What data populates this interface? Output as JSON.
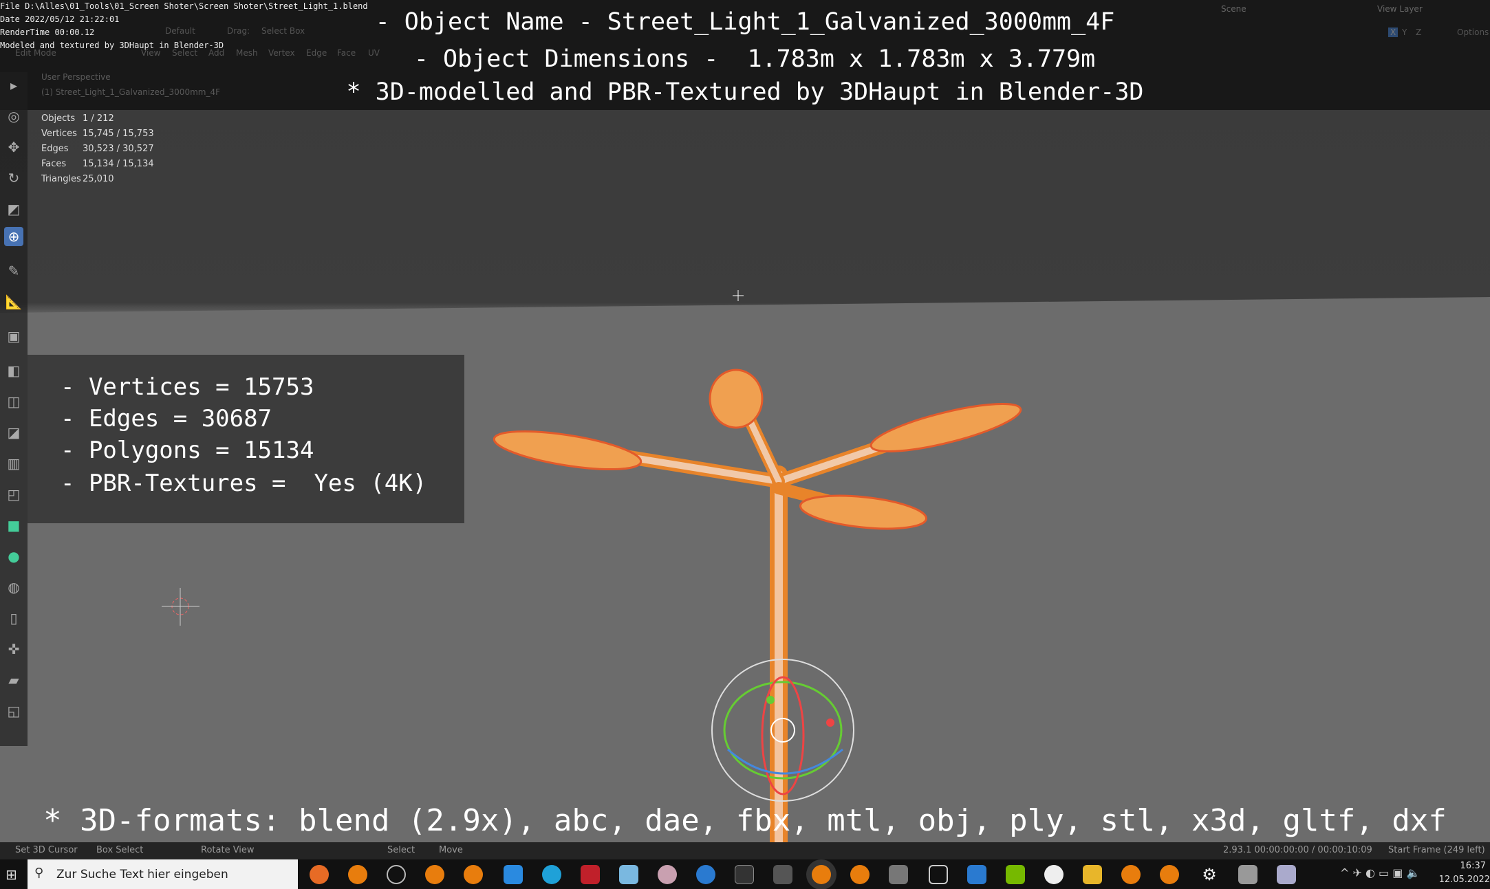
{
  "overlay": {
    "file": "File D:\\Alles\\01_Tools\\01_Screen Shoter\\Screen Shoter\\Street_Light_1.blend",
    "date": "Date 2022/05/12 21:22:01",
    "rendertime": "RenderTime 00:00.12",
    "credit": "Modeled and textured by 3DHaupt in Blender-3D"
  },
  "titles": [
    "- Object Name - Street_Light_1_Galvanized_3000mm_4F",
    "- Object Dimensions -  1.783m x 1.783m x 3.779m",
    "* 3D-modelled and PBR-Textured by 3DHaupt in Blender-3D"
  ],
  "header": {
    "mode": "Edit Mode",
    "menus": [
      "View",
      "Select",
      "Add",
      "Mesh",
      "Vertex",
      "Edge",
      "Face",
      "UV"
    ],
    "orientation": "Default",
    "drag_label": "Drag:",
    "drag_value": "Select Box",
    "scene": "Scene",
    "view_layer": "View Layer",
    "axes": [
      "X",
      "Y",
      "Z"
    ],
    "options": "Options"
  },
  "viewport": {
    "perspective": "User Perspective",
    "object": "(1) Street_Light_1_Galvanized_3000mm_4F"
  },
  "stats": [
    {
      "label": "Objects",
      "value": "1 / 212"
    },
    {
      "label": "Vertices",
      "value": "15,745 / 15,753"
    },
    {
      "label": "Edges",
      "value": "30,523 / 30,527"
    },
    {
      "label": "Faces",
      "value": "15,134 / 15,134"
    },
    {
      "label": "Triangles",
      "value": "25,010"
    }
  ],
  "info": [
    "- Vertices = 15753",
    "- Edges = 30687",
    "- Polygons = 15134",
    "- PBR-Textures =  Yes (4K)"
  ],
  "formats": "* 3D-formats: blend (2.9x), abc, dae, fbx, mtl, obj, ply, stl, x3d, gltf, dxf",
  "statusbar": {
    "left": [
      "Set 3D Cursor",
      "Box Select",
      "Rotate View",
      "Select",
      "Move"
    ],
    "version": "2.93.1  00:00:00:00 / 00:00:10:09",
    "frame": "Start Frame (249 left)"
  },
  "taskbar": {
    "search_placeholder": "Zur Suche Text hier eingeben",
    "time": "16:37",
    "date": "12.05.2022"
  },
  "colors": {
    "mesh": "#e8842a",
    "selected": "#f5a34a",
    "accent": "#4772b3"
  }
}
